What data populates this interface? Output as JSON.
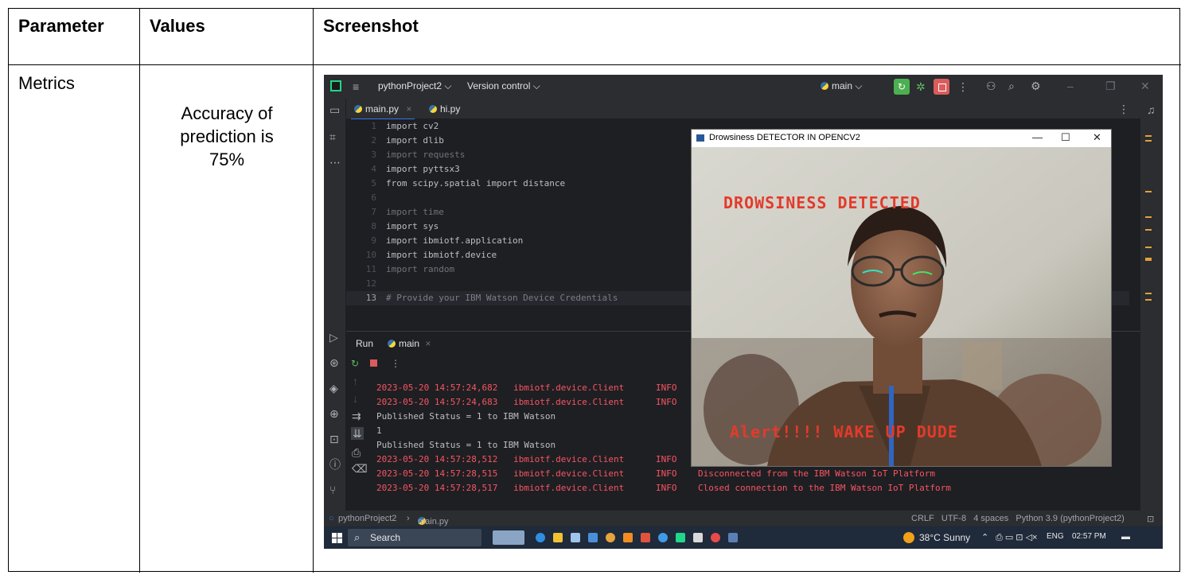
{
  "table": {
    "headers": [
      "Parameter",
      "Values",
      "Screenshot"
    ],
    "row": {
      "parameter": "Metrics",
      "value_lines": [
        "Accuracy of",
        "prediction is",
        "75%"
      ]
    }
  },
  "ide": {
    "title": {
      "project": "pythonProject2 ⌵",
      "vcs": "Version control ⌵",
      "branch": "main ⌵"
    },
    "tabs": [
      {
        "label": "main.py",
        "close": "×"
      },
      {
        "label": "hi.py"
      }
    ],
    "code_lines": [
      {
        "n": "1",
        "text": "import cv2"
      },
      {
        "n": "2",
        "text": "import dlib"
      },
      {
        "n": "3",
        "text": "import requests"
      },
      {
        "n": "4",
        "text": "import pyttsx3"
      },
      {
        "n": "5",
        "text": "from scipy.spatial import distance"
      },
      {
        "n": "6",
        "text": ""
      },
      {
        "n": "7",
        "text": "import time"
      },
      {
        "n": "8",
        "text": "import sys"
      },
      {
        "n": "9",
        "text": "import ibmiotf.application"
      },
      {
        "n": "10",
        "text": "import ibmiotf.device"
      },
      {
        "n": "11",
        "text": "import random"
      },
      {
        "n": "12",
        "text": ""
      },
      {
        "n": "13",
        "text": "# Provide your IBM Watson Device Credentials"
      }
    ],
    "run": {
      "tab_run": "Run",
      "tab_main": "main",
      "tab_close": "×",
      "console": [
        "2023-05-20 14:57:24,682   ibmiotf.device.Client      INFO",
        "2023-05-20 14:57:24,683   ibmiotf.device.Client      INFO",
        "Published Status = 1 to IBM Watson",
        "1",
        "Published Status = 1 to IBM Watson",
        "2023-05-20 14:57:28,512   ibmiotf.device.Client      INFO",
        "2023-05-20 14:57:28,515   ibmiotf.device.Client      INFO    Disconnected from the IBM Watson IoT Platform",
        "2023-05-20 14:57:28,517   ibmiotf.device.Client      INFO    Closed connection to the IBM Watson IoT Platform"
      ]
    },
    "status": {
      "breadcrumb_project": "pythonProject2",
      "breadcrumb_sep": "›",
      "breadcrumb_file": "main.py",
      "right": "CRLF   UTF-8   4 spaces   Python 3.9 (pythonProject2)"
    },
    "taskbar": {
      "search": "Search",
      "weather": "38°C  Sunny",
      "lang": "ENG",
      "time": "02:57 PM"
    },
    "cv_window": {
      "title": "Drowsiness DETECTOR IN OPENCV2",
      "min": "—",
      "max": "☐",
      "close": "✕",
      "text_top": "DROWSINESS DETECTED",
      "text_bottom": "Alert!!!! WAKE UP DUDE"
    }
  }
}
